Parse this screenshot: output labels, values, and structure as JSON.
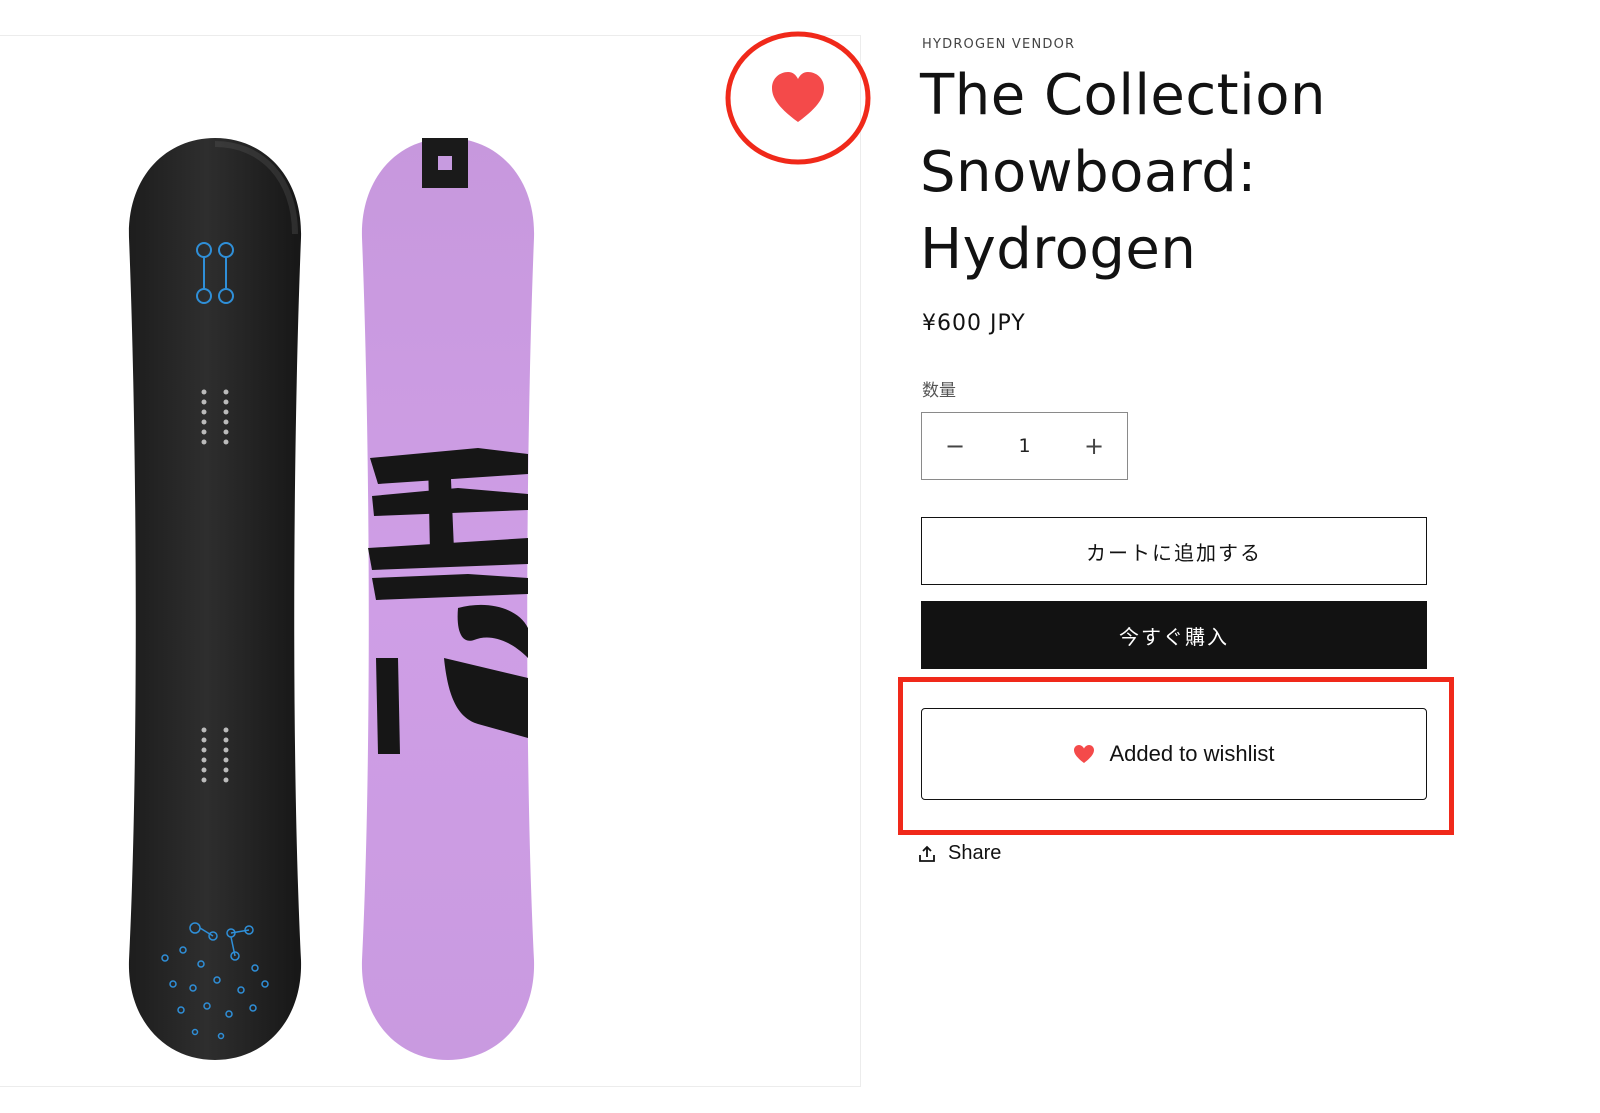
{
  "product": {
    "vendor": "HYDROGEN VENDOR",
    "title": "The Collection Snowboard: Hydrogen",
    "price": "¥600 JPY",
    "quantity_label": "数量",
    "quantity_value": "1",
    "decrement_symbol": "−",
    "increment_symbol": "+"
  },
  "actions": {
    "add_to_cart": "カートに追加する",
    "buy_now": "今すぐ購入",
    "wishlist": "Added to wishlist",
    "share": "Share"
  },
  "icons": {
    "wishlist_heart": "heart-icon",
    "share": "share-icon"
  },
  "colors": {
    "heart": "#f44a4a",
    "annotation": "#f0291a",
    "board_purple": "#c79be0",
    "board_black": "#222222",
    "button_dark": "#121212"
  }
}
